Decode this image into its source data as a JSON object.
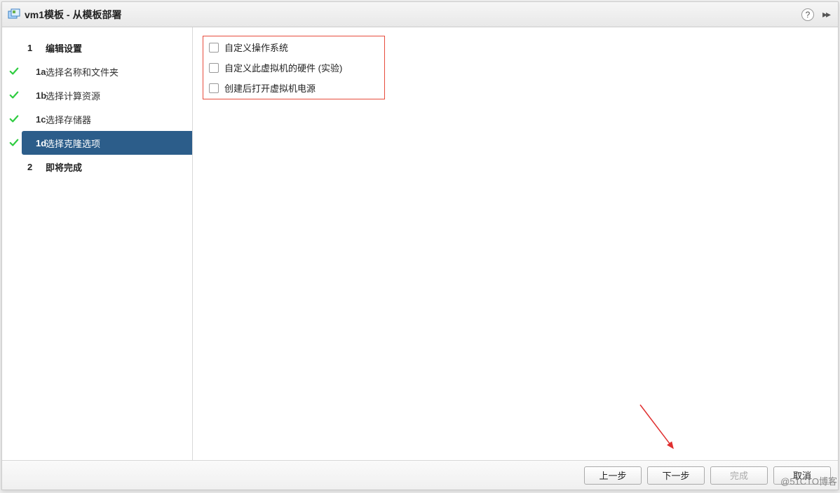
{
  "titlebar": {
    "title": "vm1模板 - 从模板部署",
    "help_label": "?"
  },
  "sidebar": {
    "steps": [
      {
        "num": "1",
        "label": "编辑设置",
        "checked": false,
        "header": true,
        "sub": false,
        "selected": false
      },
      {
        "num": "1a",
        "label": "选择名称和文件夹",
        "checked": true,
        "header": false,
        "sub": true,
        "selected": false
      },
      {
        "num": "1b",
        "label": "选择计算资源",
        "checked": true,
        "header": false,
        "sub": true,
        "selected": false
      },
      {
        "num": "1c",
        "label": "选择存储器",
        "checked": true,
        "header": false,
        "sub": true,
        "selected": false
      },
      {
        "num": "1d",
        "label": "选择克隆选项",
        "checked": true,
        "header": false,
        "sub": true,
        "selected": true
      },
      {
        "num": "2",
        "label": "即将完成",
        "checked": false,
        "header": true,
        "sub": false,
        "selected": false
      }
    ]
  },
  "content": {
    "options": [
      {
        "label": "自定义操作系统"
      },
      {
        "label": "自定义此虚拟机的硬件 (实验)"
      },
      {
        "label": "创建后打开虚拟机电源"
      }
    ]
  },
  "footer": {
    "back": "上一步",
    "next": "下一步",
    "finish": "完成",
    "cancel": "取消"
  },
  "watermark": "@51CTO博客"
}
